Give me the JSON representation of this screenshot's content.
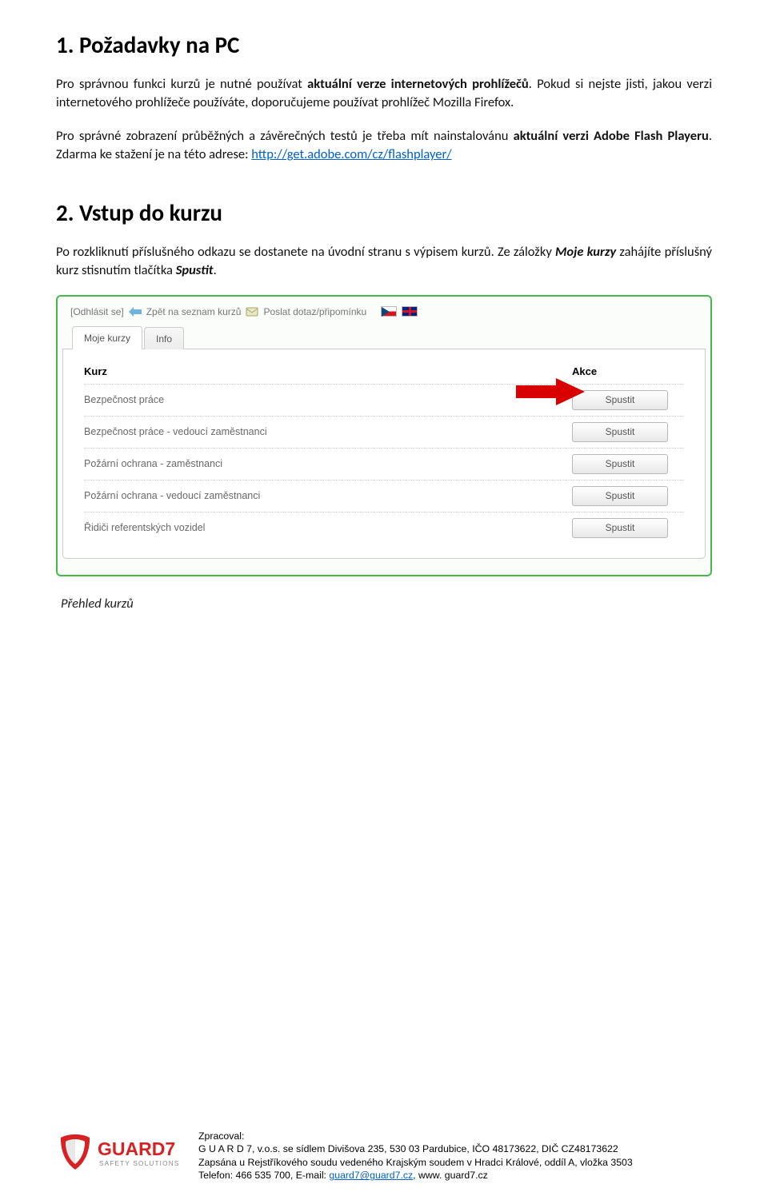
{
  "section1": {
    "heading": "1. Požadavky na PC",
    "p1_a": "Pro správnou funkci kurzů je nutné používat ",
    "p1_b": "aktuální verze internetových prohlížečů",
    "p1_c": ". Pokud si nejste jisti, jakou verzi internetového prohlížeče používáte, doporučujeme používat prohlížeč Mozilla Firefox.",
    "p2_a": "Pro správné zobrazení průběžných a závěrečných testů je třeba mít nainstalovánu ",
    "p2_b": "aktuální verzi Adobe Flash Playeru",
    "p2_c": ". Zdarma ke stažení je na této adrese: ",
    "link": "http://get.adobe.com/cz/flashplayer/"
  },
  "section2": {
    "heading": "2. Vstup do kurzu",
    "p_a": "Po rozkliknutí příslušného odkazu se dostanete na úvodní stranu s výpisem kurzů. Ze záložky ",
    "p_b": "Moje kurzy",
    "p_c": " zahájíte příslušný kurz stisnutím tlačítka ",
    "p_d": "Spustit",
    "p_e": "."
  },
  "screenshot": {
    "toolbar": {
      "logout": "[Odhlásit se]",
      "back": "Zpět na seznam kurzů",
      "feedback": "Poslat dotaz/připomínku"
    },
    "tabs": {
      "courses": "Moje kurzy",
      "info": "Info"
    },
    "header": {
      "course": "Kurz",
      "action": "Akce"
    },
    "button_label": "Spustit",
    "rows": [
      "Bezpečnost práce",
      "Bezpečnost práce - vedoucí zaměstnanci",
      "Požární ochrana - zaměstnanci",
      "Požární ochrana - vedoucí zaměstnanci",
      "Řidiči referentských vozidel"
    ],
    "caption": "Přehled kurzů"
  },
  "footer": {
    "line0": "Zpracoval:",
    "line1": "G U A R D 7, v.o.s. se sídlem Divišova 235, 530 03 Pardubice, IČO 48173622, DIČ CZ48173622",
    "line2": "Zapsána u Rejstříkového soudu vedeného Krajským soudem v Hradci Králové, oddíl A, vložka 3503",
    "line3_a": "Telefon: 466 535 700, E-mail: ",
    "email": "guard7@guard7.cz",
    "line3_b": ", www. guard7.cz",
    "logo_main": "GUARD7",
    "logo_sub": "SAFETY SOLUTIONS"
  }
}
